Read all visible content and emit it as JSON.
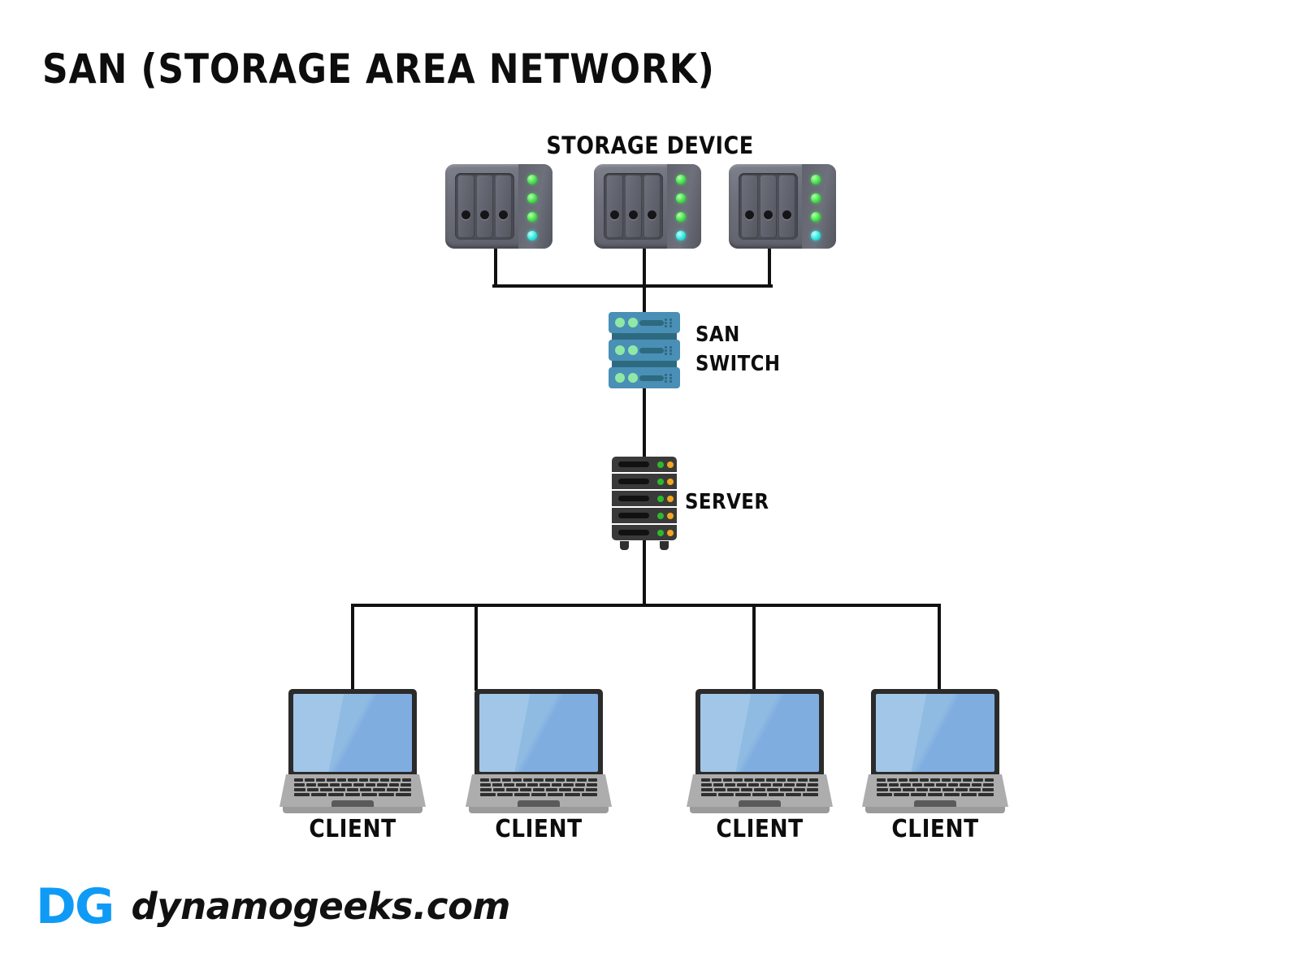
{
  "page": {
    "title": "SAN (STORAGE AREA NETWORK)",
    "background_color": "#ffffff",
    "line_color": "#111111",
    "text_color": "#0d0d0d"
  },
  "diagram": {
    "type": "network-topology",
    "topology": "bus",
    "tiers": [
      {
        "id": "storage-tier",
        "label": "STORAGE DEVICE",
        "node_count": 3,
        "node_type": "nas-storage-array"
      },
      {
        "id": "switch-tier",
        "label": "SAN SWITCH",
        "label_lines": [
          "SAN",
          "SWITCH"
        ],
        "node_count": 1,
        "node_type": "network-switch"
      },
      {
        "id": "server-tier",
        "label": "SERVER",
        "node_count": 1,
        "node_type": "rack-server"
      },
      {
        "id": "client-tier",
        "label": "CLIENT",
        "node_count": 4,
        "node_type": "laptop"
      }
    ],
    "storage_devices": [
      {
        "name": "storage-device-1",
        "bays": 3,
        "green_leds": 3,
        "cyan_leds": 1
      },
      {
        "name": "storage-device-2",
        "bays": 3,
        "green_leds": 3,
        "cyan_leds": 1
      },
      {
        "name": "storage-device-3",
        "bays": 3,
        "green_leds": 3,
        "cyan_leds": 1
      }
    ],
    "switch": {
      "name": "san-switch",
      "units": 3,
      "leds_per_unit": 2
    },
    "server": {
      "name": "server",
      "units": 5,
      "leds_per_unit": 2
    },
    "clients": [
      {
        "name": "client-1",
        "label": "CLIENT"
      },
      {
        "name": "client-2",
        "label": "CLIENT"
      },
      {
        "name": "client-3",
        "label": "CLIENT"
      },
      {
        "name": "client-4",
        "label": "CLIENT"
      }
    ],
    "labels": {
      "storage": "STORAGE DEVICE",
      "switch_line1": "SAN",
      "switch_line2": "SWITCH",
      "server": "SERVER",
      "client": "CLIENT"
    },
    "colors": {
      "storage_body": "#6d6f7a",
      "storage_led_green": "#44e24a",
      "storage_led_cyan": "#2ee8e0",
      "switch_body": "#4a8fb5",
      "switch_accent": "#2d6a80",
      "switch_led": "#8fe8a5",
      "server_body": "#3a3a3a",
      "server_led_green": "#2eb82e",
      "server_led_orange": "#f0a71e",
      "laptop_bezel": "#2b2b2b",
      "laptop_screen": "#8fbbe3",
      "laptop_base": "#adadad"
    }
  },
  "footer": {
    "logo_text": "DG",
    "logo_color": "#0f9bf5",
    "domain": "dynamogeeks.com"
  }
}
